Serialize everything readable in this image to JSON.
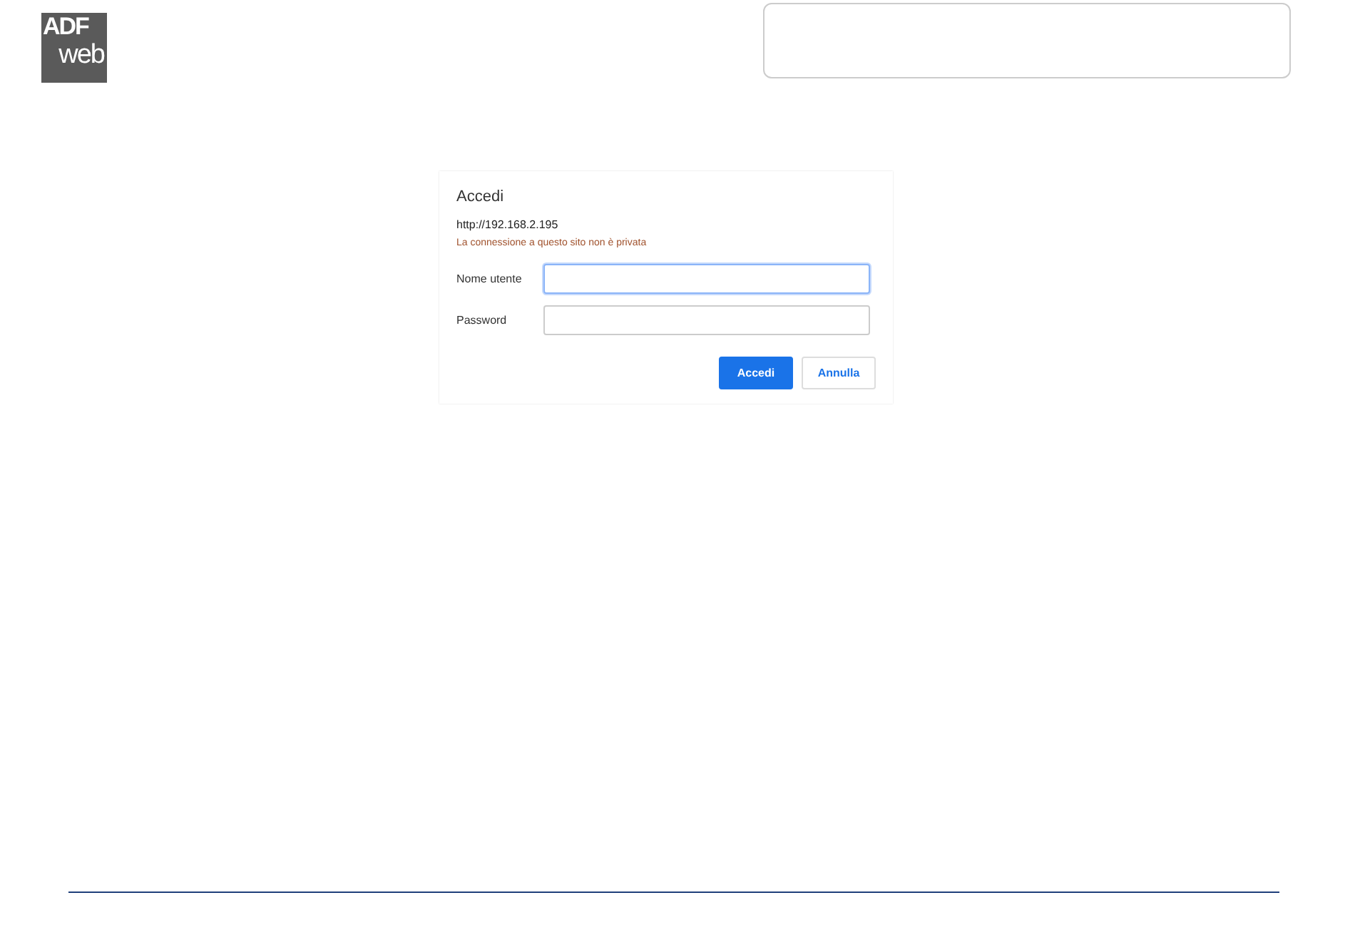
{
  "logo": {
    "top": "ADF",
    "bottom": "web"
  },
  "dialog": {
    "title": "Accedi",
    "url": "http://192.168.2.195",
    "warning": "La connessione a questo sito non è privata",
    "fields": [
      {
        "label": "Nome utente",
        "focused": true
      },
      {
        "label": "Password",
        "focused": false
      }
    ],
    "buttons": [
      {
        "label": "Accedi",
        "kind": "primary"
      },
      {
        "label": "Annulla",
        "kind": "secondary"
      }
    ]
  }
}
